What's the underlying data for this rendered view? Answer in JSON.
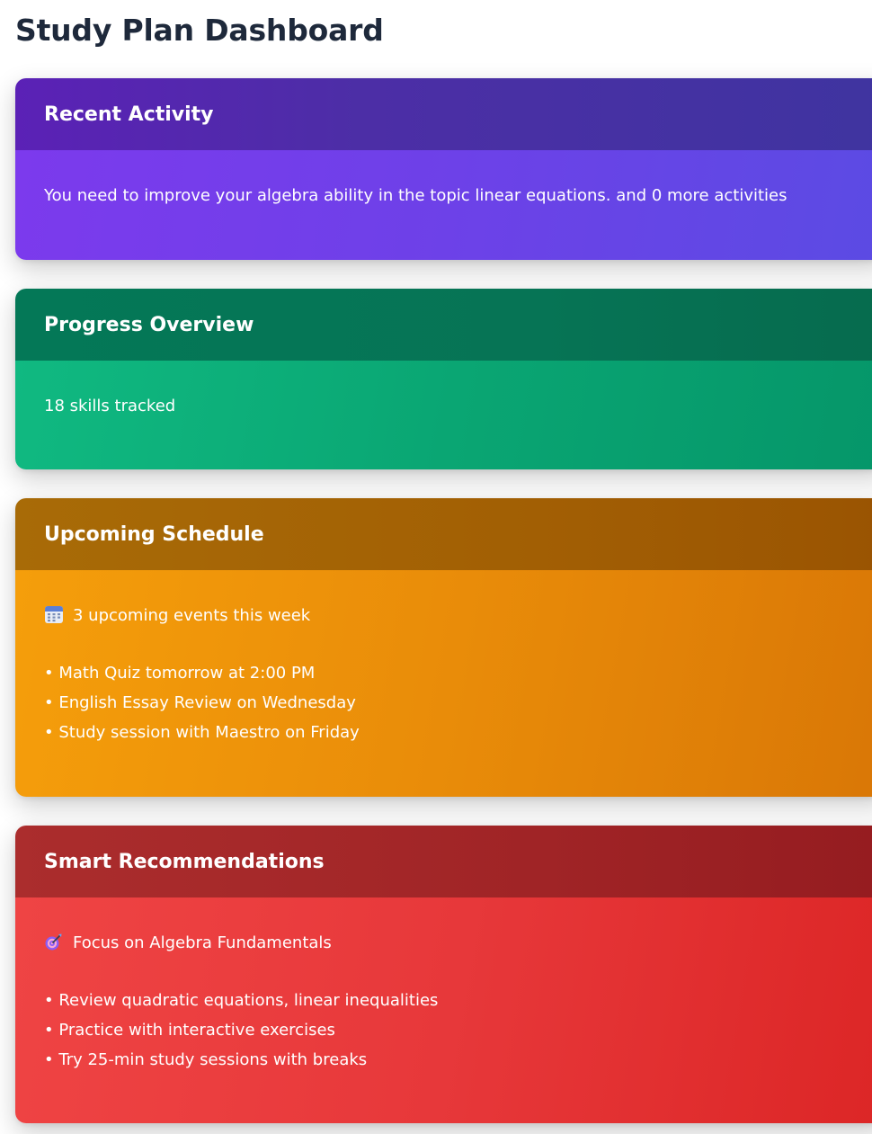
{
  "page": {
    "title": "Study Plan Dashboard"
  },
  "cards": {
    "recent_activity": {
      "title": "Recent Activity",
      "text": "You need to improve your algebra ability in the topic linear equations. and 0 more activities",
      "header_color": "#4c2ea6",
      "body_color": "#6d41e8"
    },
    "progress_overview": {
      "title": "Progress Overview",
      "text": "18 skills tracked",
      "header_color": "#067455",
      "body_color": "#0aa673"
    },
    "upcoming_schedule": {
      "title": "Upcoming Schedule",
      "summary_icon": "calendar-icon",
      "summary": "3 upcoming events this week",
      "items": [
        "• Math Quiz tomorrow at 2:00 PM",
        "• English Essay Review on Wednesday",
        "• Study session with Maestro on Friday"
      ],
      "header_color": "#a25f04",
      "body_color": "#e98c09"
    },
    "smart_recommendations": {
      "title": "Smart Recommendations",
      "summary_icon": "target-icon",
      "summary": "Focus on Algebra Fundamentals",
      "items": [
        "• Review quadratic equations, linear inequalities",
        "• Practice with interactive exercises",
        "• Try 25-min study sessions with breaks"
      ],
      "header_color": "#a02426",
      "body_color": "#e7383a"
    }
  }
}
